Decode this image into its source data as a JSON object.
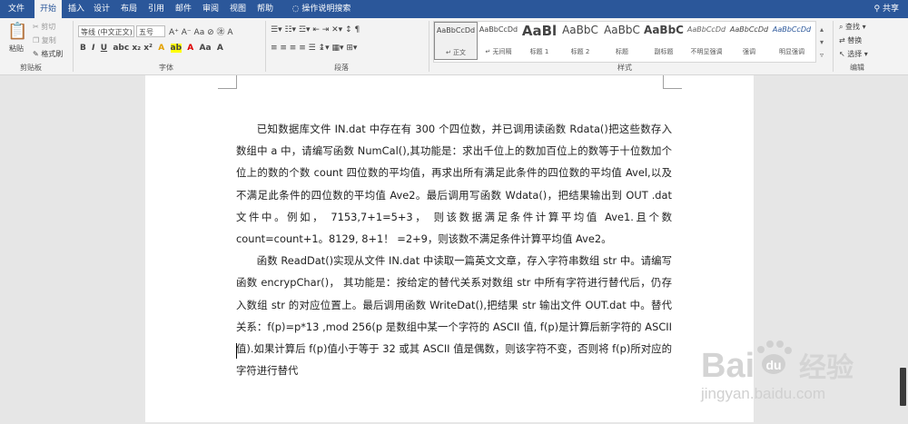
{
  "tabs": [
    "文件",
    "开始",
    "插入",
    "设计",
    "布局",
    "引用",
    "邮件",
    "审阅",
    "视图",
    "帮助"
  ],
  "active_tab": "开始",
  "tell_me": "操作说明搜索",
  "share": "共享",
  "clipboard": {
    "paste": "粘贴",
    "cut": "剪切",
    "copy": "复制",
    "format_painter": "格式刷",
    "label": "剪贴板"
  },
  "font": {
    "name": "等线 (中文正文)",
    "size": "五号",
    "label": "字体"
  },
  "paragraph": {
    "label": "段落"
  },
  "styles": {
    "label": "样式",
    "items": [
      {
        "sample": "AaBbCcDd",
        "name": "↵ 正文"
      },
      {
        "sample": "AaBbCcDd",
        "name": "↵ 无间隔"
      },
      {
        "sample": "AaBl",
        "name": "标题 1"
      },
      {
        "sample": "AaBbC",
        "name": "标题 2"
      },
      {
        "sample": "AaBbC",
        "name": "标题"
      },
      {
        "sample": "AaBbC",
        "name": "副标题"
      },
      {
        "sample": "AaBbCcDd",
        "name": "不明显强调"
      },
      {
        "sample": "AaBbCcDd",
        "name": "强调"
      },
      {
        "sample": "AaBbCcDd",
        "name": "明显强调"
      }
    ]
  },
  "editing": {
    "find": "查找",
    "replace": "替换",
    "select": "选择",
    "label": "编辑"
  },
  "document": {
    "paragraphs": [
      "已知数据库文件 IN.dat 中存在有 300 个四位数，并已调用读函数 Rdata()把这些数存入数组中 a 中，请编写函数 NumCal(),其功能是：求出千位上的数加百位上的数等于十位数加个位上的数的个数 count 四位数的平均值，再求出所有满足此条件的四位数的平均值 Avel,以及不满足此条件的四位数的平均值  Ave2。最后调用写函数  Wdata()，把结果输出到 OUT .dat  文件中。例如， 7153,7+1=5+3， 则该数据满足条件计算平均值  Ave1.且个数 count=count+1。8129,   8+1！ =2+9，则该数不满足条件计算平均值 Ave2。",
      "函数 ReadDat()实现从文件 IN.dat 中读取一篇英文文章，存入字符串数组 str 中。请编写函数 encrypChar()， 其功能是：按给定的替代关系对数组 str 中所有字符进行替代后，仍存入数组 str 的对应位置上。最后调用函数 WriteDat(),把结果 str 输出文件 OUT.dat 中。替代关系：f(p)=p*13 ,mod 256(p 是数组中某一个字符的 ASCII 值, f(p)是计算后新字符的 ASCII 值).如果计算后 f(p)值小于等于 32 或其 ASCII 值是偶数，则该字符不变，否则将 f(p)所对应的字符进行替代"
    ]
  },
  "watermark": {
    "brand": "Bai",
    "brand2": "经验",
    "url": "jingyan.baidu.com"
  }
}
